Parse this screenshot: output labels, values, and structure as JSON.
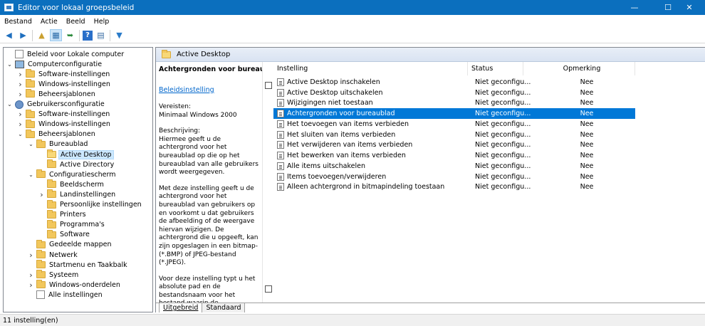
{
  "window": {
    "title": "Editor voor lokaal groepsbeleid"
  },
  "window_controls": {
    "minimize": "—",
    "maximize": "☐",
    "close": "✕"
  },
  "menu": [
    "Bestand",
    "Actie",
    "Beeld",
    "Help"
  ],
  "toolbar_icons": [
    "arrow-left-icon",
    "arrow-right-icon",
    "folder-up-icon",
    "show-hide-tree-icon",
    "export-list-icon",
    "help-icon",
    "properties-icon",
    "filter-icon"
  ],
  "tree": [
    {
      "label": "Beleid voor Lokale computer",
      "icon": "all",
      "level": 0,
      "expander": ""
    },
    {
      "label": "Computerconfiguratie",
      "icon": "computer",
      "level": 0,
      "expander": "open"
    },
    {
      "label": "Software-instellingen",
      "icon": "folder",
      "level": 1,
      "expander": "closed"
    },
    {
      "label": "Windows-instellingen",
      "icon": "folder",
      "level": 1,
      "expander": "closed"
    },
    {
      "label": "Beheersjablonen",
      "icon": "folder",
      "level": 1,
      "expander": "closed"
    },
    {
      "label": "Gebruikersconfiguratie",
      "icon": "user",
      "level": 0,
      "expander": "open"
    },
    {
      "label": "Software-instellingen",
      "icon": "folder",
      "level": 1,
      "expander": "closed"
    },
    {
      "label": "Windows-instellingen",
      "icon": "folder",
      "level": 1,
      "expander": "closed"
    },
    {
      "label": "Beheersjablonen",
      "icon": "folder",
      "level": 1,
      "expander": "open"
    },
    {
      "label": "Bureaublad",
      "icon": "folder",
      "level": 2,
      "expander": "open"
    },
    {
      "label": "Active Desktop",
      "icon": "folder-open",
      "level": 3,
      "expander": "",
      "selected": true
    },
    {
      "label": "Active Directory",
      "icon": "folder",
      "level": 3,
      "expander": ""
    },
    {
      "label": "Configuratiescherm",
      "icon": "folder",
      "level": 2,
      "expander": "open"
    },
    {
      "label": "Beeldscherm",
      "icon": "folder",
      "level": 3,
      "expander": ""
    },
    {
      "label": "Landinstellingen",
      "icon": "folder",
      "level": 3,
      "expander": "closed"
    },
    {
      "label": "Persoonlijke instellingen",
      "icon": "folder",
      "level": 3,
      "expander": ""
    },
    {
      "label": "Printers",
      "icon": "folder",
      "level": 3,
      "expander": ""
    },
    {
      "label": "Programma's",
      "icon": "folder",
      "level": 3,
      "expander": ""
    },
    {
      "label": "Software",
      "icon": "folder",
      "level": 3,
      "expander": ""
    },
    {
      "label": "Gedeelde mappen",
      "icon": "folder",
      "level": 2,
      "expander": ""
    },
    {
      "label": "Netwerk",
      "icon": "folder",
      "level": 2,
      "expander": "closed"
    },
    {
      "label": "Startmenu en Taakbalk",
      "icon": "folder",
      "level": 2,
      "expander": ""
    },
    {
      "label": "Systeem",
      "icon": "folder",
      "level": 2,
      "expander": "closed"
    },
    {
      "label": "Windows-onderdelen",
      "icon": "folder",
      "level": 2,
      "expander": "closed"
    },
    {
      "label": "Alle instellingen",
      "icon": "all",
      "level": 2,
      "expander": ""
    }
  ],
  "right_header": {
    "title": "Active Desktop"
  },
  "extended": {
    "title": "Achtergronden voor bureaublad",
    "link": "Beleidsinstelling",
    "req": "Vereisten:\nMinimaal Windows 2000",
    "desc1": "Beschrijving:\nHiermee geeft u de achtergrond voor het bureaublad op die op het bureaublad van alle gebruikers wordt weergegeven.",
    "desc2": "Met deze instelling geeft u de achtergrond voor het bureaublad van gebruikers op en voorkomt u dat gebruikers de afbeelding of de weergave hiervan wijzigen. De achtergrond die u opgeeft, kan zijn opgeslagen in een bitmap- (*.BMP) of JPEG-bestand (*.JPEG).",
    "desc3": "Voor deze instelling typt u het absolute pad en de bestandsnaam voor het bestand waarin de achtergrondafbeelding is opgeslagen. U kunt een lokaal pad typen, zoals"
  },
  "columns": {
    "name": "Instelling",
    "status": "Status",
    "comment": "Opmerking"
  },
  "settings": [
    {
      "name": "Active Desktop inschakelen",
      "status": "Niet geconfigu...",
      "comment": "Nee"
    },
    {
      "name": "Active Desktop uitschakelen",
      "status": "Niet geconfigu...",
      "comment": "Nee"
    },
    {
      "name": "Wijzigingen niet toestaan",
      "status": "Niet geconfigu...",
      "comment": "Nee"
    },
    {
      "name": "Achtergronden voor bureaublad",
      "status": "Niet geconfigu...",
      "comment": "Nee",
      "selected": true
    },
    {
      "name": "Het toevoegen van items verbieden",
      "status": "Niet geconfigu...",
      "comment": "Nee"
    },
    {
      "name": "Het sluiten van items verbieden",
      "status": "Niet geconfigu...",
      "comment": "Nee"
    },
    {
      "name": "Het verwijderen van items verbieden",
      "status": "Niet geconfigu...",
      "comment": "Nee"
    },
    {
      "name": "Het bewerken van items verbieden",
      "status": "Niet geconfigu...",
      "comment": "Nee"
    },
    {
      "name": "Alle items uitschakelen",
      "status": "Niet geconfigu...",
      "comment": "Nee"
    },
    {
      "name": "Items toevoegen/verwijderen",
      "status": "Niet geconfigu...",
      "comment": "Nee"
    },
    {
      "name": "Alleen achtergrond in bitmapindeling toestaan",
      "status": "Niet geconfigu...",
      "comment": "Nee"
    }
  ],
  "tabs": [
    {
      "label": "Uitgebreid",
      "active": true
    },
    {
      "label": "Standaard",
      "active": false
    }
  ],
  "status": {
    "text": "11 instelling(en)"
  }
}
